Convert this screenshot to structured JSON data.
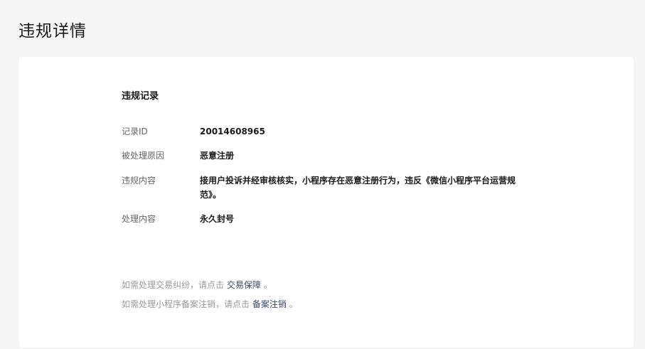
{
  "page": {
    "title": "违规详情"
  },
  "record": {
    "section_title": "违规记录",
    "fields": [
      {
        "label": "记录ID",
        "value": "20014608965"
      },
      {
        "label": "被处理原因",
        "value": "恶意注册"
      },
      {
        "label": "违规内容",
        "value": "接用户投诉并经审核核实，小程序存在恶意注册行为，违反《微信小程序平台运营规范》。"
      },
      {
        "label": "处理内容",
        "value": "永久封号"
      }
    ]
  },
  "notes": {
    "trade": {
      "prefix": "如需处理交易纠纷，请点击 ",
      "link": "交易保障",
      "suffix": " 。"
    },
    "filing": {
      "prefix": "如需处理小程序备案注销，请点击 ",
      "link": "备案注销",
      "suffix": " 。"
    }
  }
}
